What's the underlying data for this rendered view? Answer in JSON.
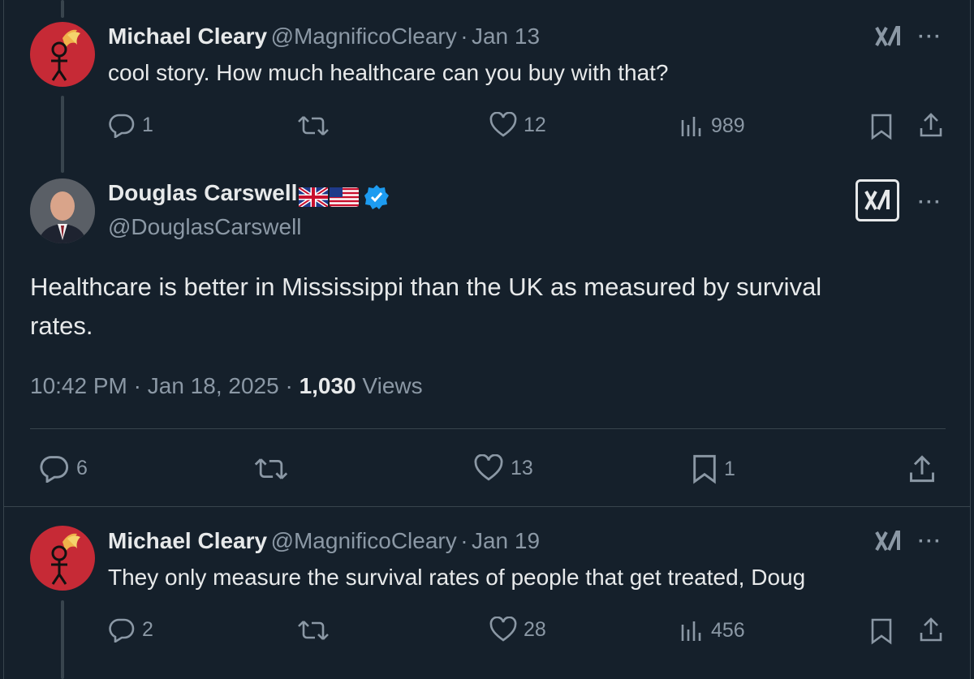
{
  "reply1": {
    "name": "Michael Cleary",
    "handle": "@MagnificoCleary",
    "separator": "·",
    "date": "Jan 13",
    "text": "cool story. How much healthcare can you buy with that?",
    "replies": "1",
    "likes": "12",
    "views": "989"
  },
  "main": {
    "name": "Douglas Carswell",
    "handle": "@DouglasCarswell",
    "text_line1": "Healthcare is better in Mississippi than the UK as measured by survival",
    "text_line2": "rates.",
    "time": "10:42 PM",
    "date": "Jan 18, 2025",
    "views_count": "1,030",
    "views_label": "Views",
    "replies": "6",
    "likes": "13",
    "bookmarks": "1"
  },
  "reply2": {
    "name": "Michael Cleary",
    "handle": "@MagnificoCleary",
    "separator": "·",
    "date": "Jan 19",
    "text": "They only measure the survival rates of people that get treated, Doug",
    "replies": "2",
    "likes": "28",
    "views": "456"
  },
  "icons": {
    "reply": "reply-icon",
    "retweet": "retweet-icon",
    "like": "heart-icon",
    "views": "analytics-icon",
    "bookmark": "bookmark-icon",
    "share": "share-icon",
    "grok": "grok-icon",
    "more": "more-icon",
    "verified": "verified-badge-icon"
  },
  "colors": {
    "background": "#15202b",
    "text": "#e7e9ea",
    "muted": "#8b98a5",
    "verified": "#1d9bf0",
    "avatar_red": "#c62a36"
  }
}
